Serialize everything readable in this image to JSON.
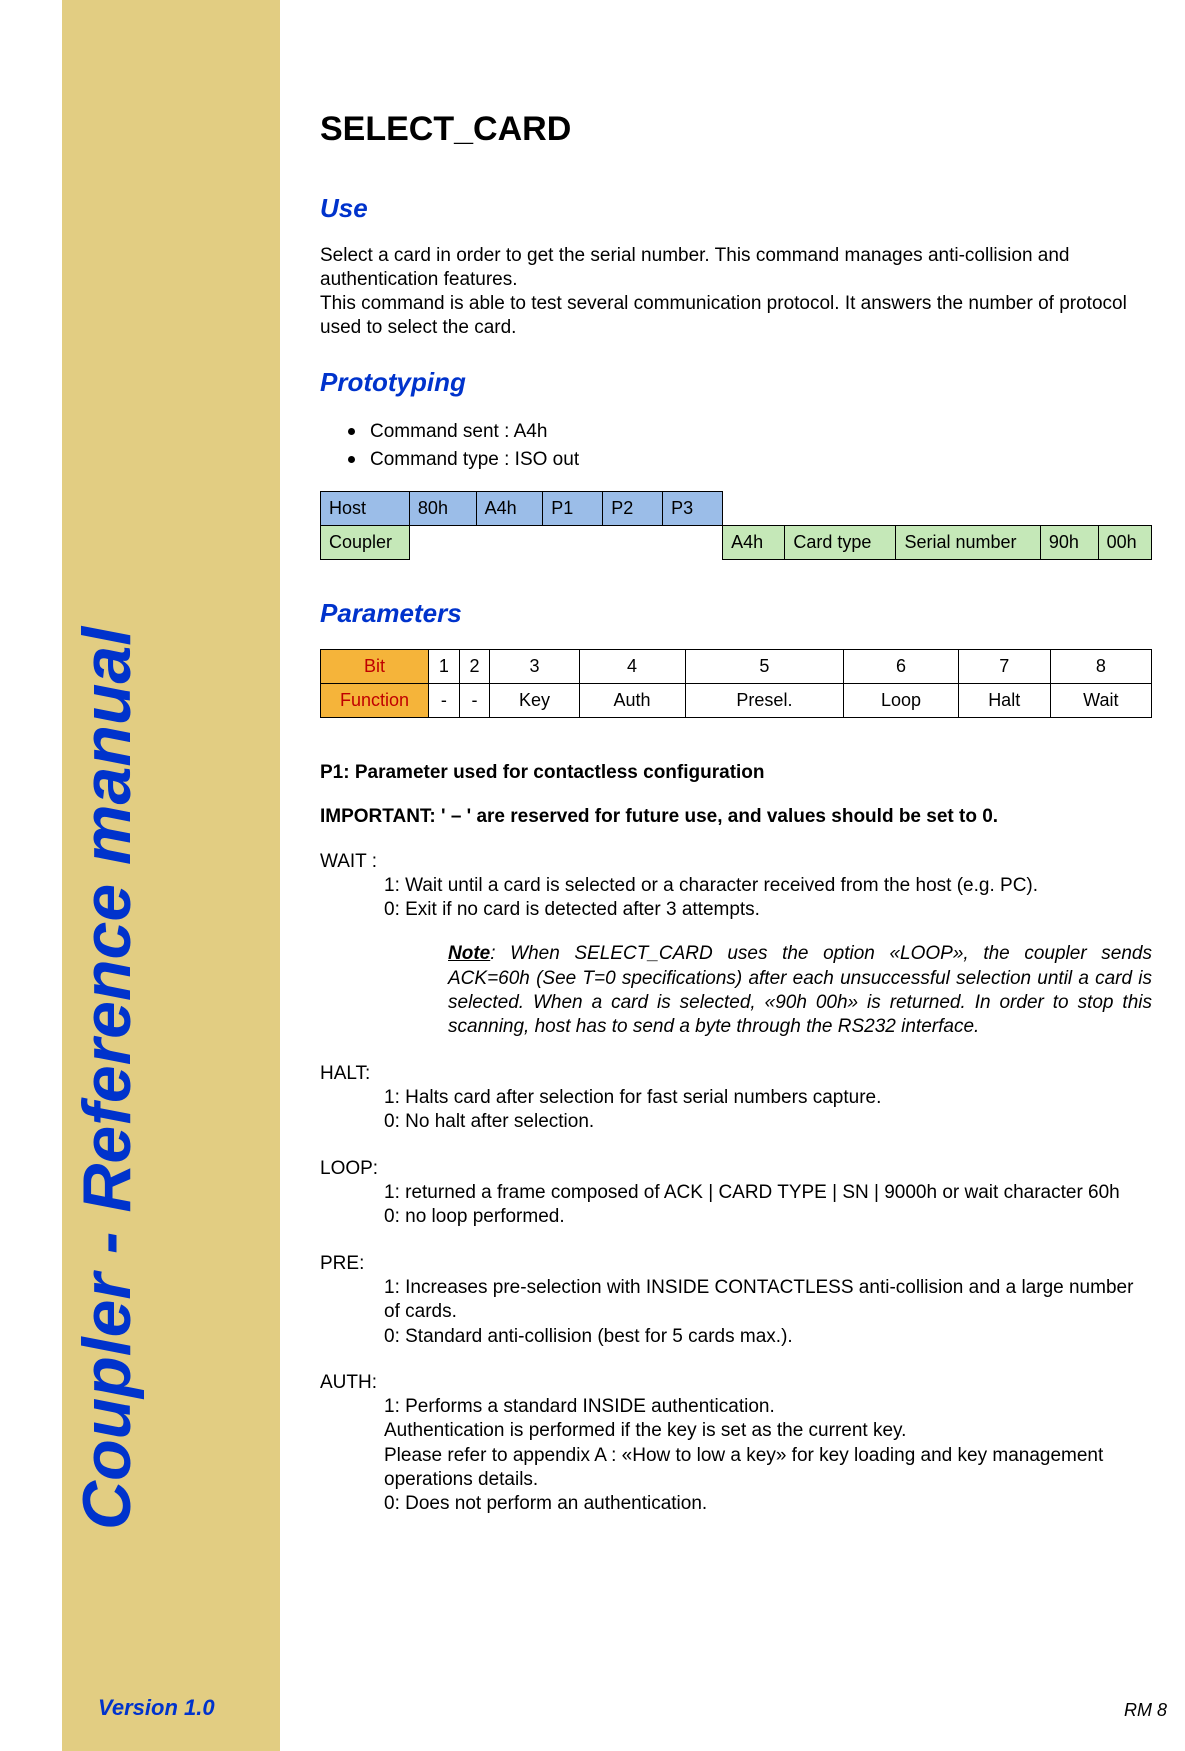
{
  "spine": "Coupler - Reference manual",
  "version": "Version 1.0",
  "footer_right": "RM 8",
  "title": "SELECT_CARD",
  "sections": {
    "use": {
      "heading": "Use",
      "p1": "Select a card in order to get the serial number. This command manages anti-collision and authentication features.",
      "p2": "This command is able to test several communication protocol. It answers the number of protocol used to select the card."
    },
    "prototyping": {
      "heading": "Prototyping",
      "bullets": [
        "Command sent : A4h",
        "Command type : ISO out"
      ],
      "table": {
        "row1": [
          "Host",
          "80h",
          "A4h",
          "P1",
          "P2",
          "P3"
        ],
        "row2_label": "Coupler",
        "row2_cells": [
          "A4h",
          "Card type",
          "Serial number",
          "90h",
          "00h"
        ]
      }
    },
    "parameters": {
      "heading": "Parameters",
      "table": {
        "header_label": "Bit",
        "bits": [
          "1",
          "2",
          "3",
          "4",
          "5",
          "6",
          "7",
          "8"
        ],
        "func_label": "Function",
        "funcs": [
          "-",
          "-",
          "Key",
          "Auth",
          "Presel.",
          "Loop",
          "Halt",
          "Wait"
        ]
      },
      "p1_heading": "P1: Parameter used for contactless configuration",
      "important": "IMPORTANT: ' – ' are reserved for future use, and values should be set to 0.",
      "wait": {
        "label": "WAIT :",
        "l1": "1: Wait until a card is selected or a character received from the host (e.g. PC).",
        "l0": "0: Exit if no card is detected after 3 attempts.",
        "note_label": "Note",
        "note": ": When SELECT_CARD uses the option «LOOP», the coupler sends ACK=60h (See T=0 specifications) after each unsuccessful selection until a card is selected. When a card is selected, «90h 00h» is returned. In order to stop this scanning, host has to send a byte through the RS232 interface."
      },
      "halt": {
        "label": "HALT:",
        "l1": "1: Halts card after selection for fast serial numbers capture.",
        "l0": "0: No halt after selection."
      },
      "loop": {
        "label": "LOOP:",
        "l1": "1: returned a frame composed of ACK | CARD TYPE | SN | 9000h or wait character 60h",
        "l0": "0: no loop performed."
      },
      "pre": {
        "label": "PRE:",
        "l1": "1: Increases pre-selection with INSIDE CONTACTLESS anti-collision and a large number of cards.",
        "l0": "0: Standard anti-collision (best for 5 cards max.)."
      },
      "auth": {
        "label": "AUTH:",
        "l1": "1: Performs a standard INSIDE authentication.",
        "l2": "Authentication is performed if the key is set as the current key.",
        "l3": "Please refer to appendix A : «How to low a key» for key loading and key management operations details.",
        "l0": "0: Does not perform an authentication."
      }
    }
  }
}
